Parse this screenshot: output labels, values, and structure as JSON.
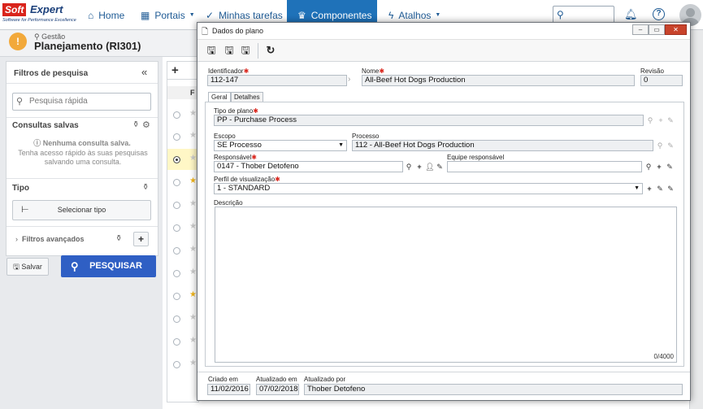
{
  "logo": {
    "brand_a": "Soft",
    "brand_b": "Expert",
    "tagline": "Software for Performance Excellence"
  },
  "nav": {
    "home": "Home",
    "portals": "Portais",
    "tasks": "Minhas tarefas",
    "components": "Componentes",
    "shortcuts": "Atalhos"
  },
  "header": {
    "breadcrumb": "Gestão",
    "title": "Planejamento (RI301)"
  },
  "sidebar": {
    "filters_title": "Filtros de pesquisa",
    "quick_search_placeholder": "Pesquisa rápida",
    "saved_queries_title": "Consultas salvas",
    "no_saved": "Nenhuma consulta salva.",
    "saved_hint": "Tenha acesso rápido às suas pesquisas salvando uma consulta.",
    "type_title": "Tipo",
    "select_type": "Selecionar tipo",
    "advanced_filters": "Filtros avançados",
    "save_label": "Salvar",
    "search_label": "PESQUISAR"
  },
  "list_header": "F",
  "dialog": {
    "title": "Dados do plano",
    "identifier_label": "Identificador",
    "identifier_value": "112-147",
    "name_label": "Nome",
    "name_value": "All-Beef Hot Dogs Production",
    "revision_label": "Revisão",
    "revision_value": "0",
    "tabs": [
      "Geral",
      "Detalhes"
    ],
    "plan_type_label": "Tipo de plano",
    "plan_type_value": "PP - Purchase Process",
    "scope_label": "Escopo",
    "scope_value": "SE Processo",
    "process_label": "Processo",
    "process_value": "112 - All-Beef Hot Dogs Production",
    "responsible_label": "Responsável",
    "responsible_value": "0147 - Thober Detofeno",
    "team_label": "Equipe responsável",
    "team_value": "",
    "view_profile_label": "Perfil de visualização",
    "view_profile_value": "1 - STANDARD",
    "description_label": "Descrição",
    "description_counter": "0/4000",
    "created_label": "Criado em",
    "created_value": "11/02/2016",
    "updated_label": "Atualizado em",
    "updated_value": "07/02/2018",
    "updated_by_label": "Atualizado por",
    "updated_by_value": "Thober Detofeno"
  },
  "colors": {
    "nav_active": "#1f72b9",
    "primary_button": "#2f5fc4",
    "warning": "#f2a93b",
    "required": "#d9241b",
    "star": "#f2b61c"
  },
  "icons": [
    "home-icon",
    "grid-icon",
    "check-icon",
    "trophy-icon",
    "bolt-icon",
    "search-icon",
    "bell-icon",
    "help-icon",
    "avatar-icon",
    "warning-icon",
    "pin-icon",
    "save-new-icon",
    "save-icon",
    "save-close-icon",
    "refresh-icon",
    "lookup-icon",
    "add-icon",
    "user-icon",
    "clear-icon",
    "edit-icon"
  ]
}
